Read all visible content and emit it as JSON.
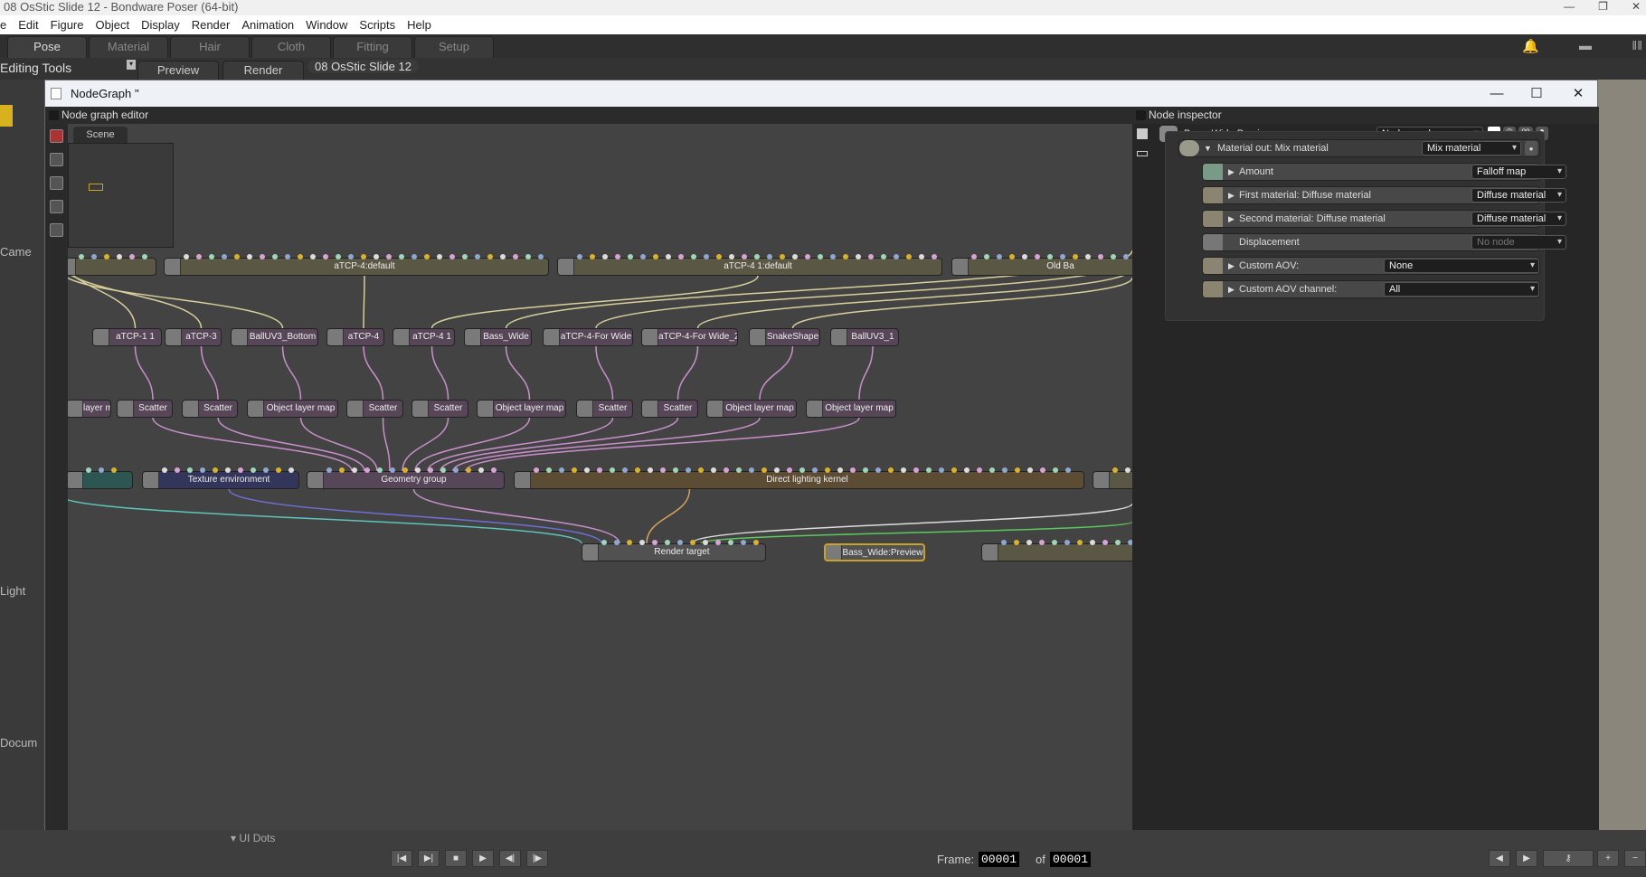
{
  "app": {
    "title": "08 OsStic Slide 12 - Bondware Poser (64-bit)"
  },
  "menu": [
    "e",
    "Edit",
    "Figure",
    "Object",
    "Display",
    "Render",
    "Animation",
    "Window",
    "Scripts",
    "Help"
  ],
  "tabs": [
    "Pose",
    "Material",
    "Hair",
    "Cloth",
    "Fitting",
    "Setup"
  ],
  "subtabs": {
    "preview": "Preview",
    "render": "Render",
    "scene_name": "08 OsStic Slide 12"
  },
  "left_panel": {
    "title": "Editing Tools",
    "camera": "Came",
    "light": "Light",
    "document": "Docum"
  },
  "nodegraph_window": {
    "title": "NodeGraph ''",
    "editor_label": "Node graph editor",
    "scene_tab": "Scene"
  },
  "nodes": {
    "row1": [
      "",
      "aTCP-4:default",
      "aTCP-4 1:default",
      "Old Ba"
    ],
    "row2": [
      "",
      "aTCP-1 1",
      "aTCP-3",
      "BallUV3_Bottom",
      "aTCP-4",
      "aTCP-4 1",
      "Bass_Wide",
      "aTCP-4-For Wide",
      "aTCP-4-For Wide_2",
      "SnakeShape",
      "BallUV3_1"
    ],
    "row3": [
      "layer map",
      "Scatter",
      "Scatter",
      "Object layer map",
      "Scatter",
      "Scatter",
      "Object layer map",
      "Scatter",
      "Scatter",
      "Object layer map",
      "Object layer map"
    ],
    "row4": [
      "",
      "Texture environment",
      "Geometry group",
      "Direct lighting kernel",
      ""
    ],
    "row5": [
      "Render target",
      "Bass_Wide:Preview",
      ""
    ]
  },
  "inspector": {
    "title": "Node inspector",
    "node_name": "Bass_Wide:Preview",
    "mode": "Node graph",
    "material_out": {
      "label": "Material out: Mix material",
      "value": "Mix material"
    },
    "params": [
      {
        "label": "Amount",
        "value": "Falloff map",
        "icon": "falloff-icon"
      },
      {
        "label": "First material: Diffuse material",
        "value": "Diffuse material",
        "icon": "sphere-icon"
      },
      {
        "label": "Second material: Diffuse material",
        "value": "Diffuse material",
        "icon": "sphere-icon"
      },
      {
        "label": "Displacement",
        "value": "No node",
        "icon": "empty-icon"
      },
      {
        "label": "Custom AOV:",
        "value": "None",
        "icon": "aov-icon"
      },
      {
        "label": "Custom AOV channel:",
        "value": "All",
        "icon": "aov-icon"
      }
    ]
  },
  "bottom": {
    "ui_dots": "UI Dots",
    "frame_label": "Frame:",
    "frame": "00001",
    "of": "of",
    "total": "00001"
  },
  "colors": {
    "accent": "#c9a227",
    "wire_yellow": "#d8cf9a",
    "wire_pink": "#c98fcc",
    "wire_blue": "#6e6fd6",
    "wire_teal": "#5cc6b8",
    "wire_orange": "#d8a25a",
    "wire_green": "#5bc95b"
  }
}
